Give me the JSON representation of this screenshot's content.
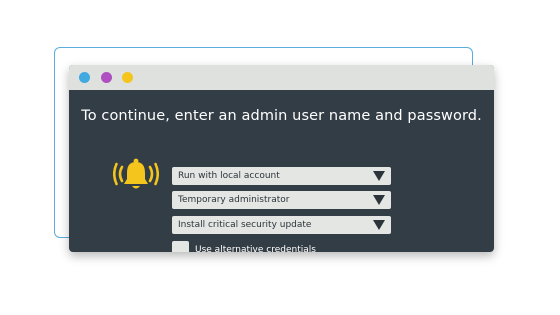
{
  "window": {
    "controls": [
      "close",
      "minimize",
      "maximize"
    ],
    "colors": {
      "close": "#3fa9e0",
      "minimize": "#b04fc1",
      "maximize": "#f4c51c",
      "background": "#333d45",
      "titlebar": "#dfe1de",
      "bell": "#f4c51c"
    }
  },
  "dialog": {
    "prompt": "To continue, enter an admin user name and password.",
    "icon": "bell-alert-icon",
    "dropdowns": [
      {
        "selected": "Run with local account"
      },
      {
        "selected": "Temporary administrator"
      },
      {
        "selected": "Install critical security update"
      }
    ],
    "checkbox": {
      "label": "Use alternative credentials",
      "checked": false
    }
  }
}
